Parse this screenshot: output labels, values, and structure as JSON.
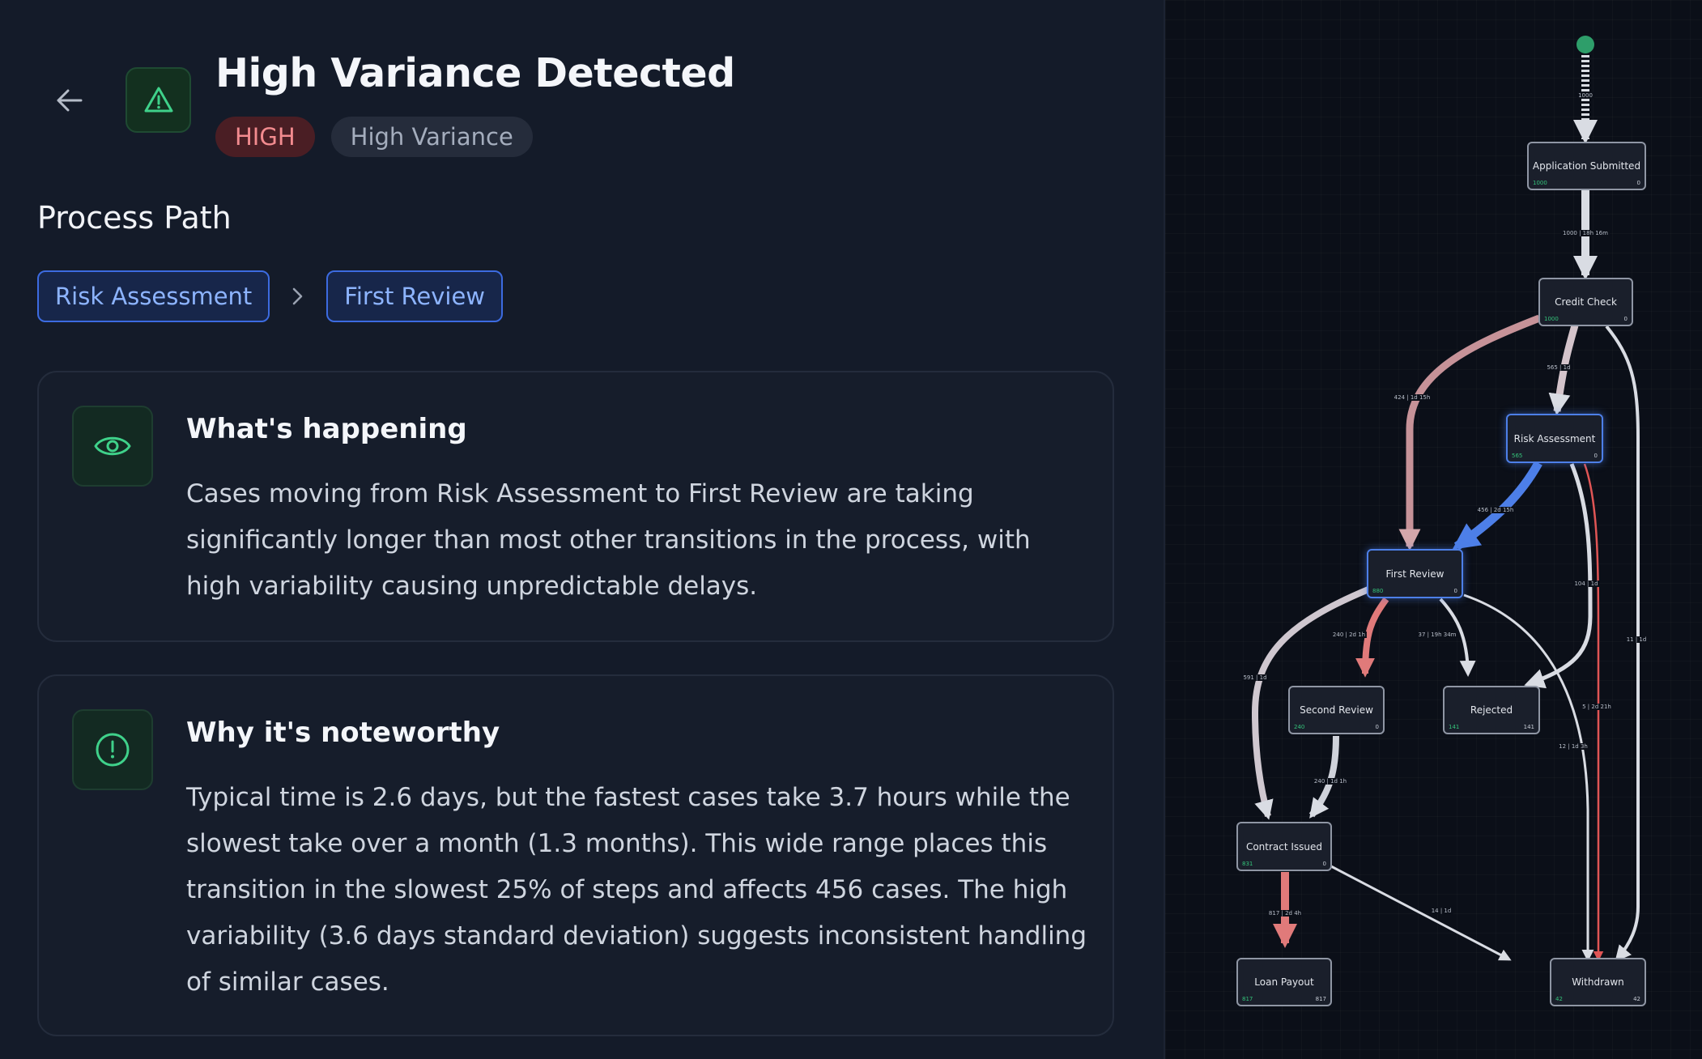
{
  "header": {
    "title": "High Variance Detected",
    "severity_badge": "HIGH",
    "type_badge": "High Variance"
  },
  "process_path": {
    "title": "Process Path",
    "steps": [
      "Risk Assessment",
      "First Review"
    ]
  },
  "cards": [
    {
      "title": "What's happening",
      "text": "Cases moving from Risk Assessment to First Review are taking significantly longer than most other transitions in the process, with high variability causing unpredictable delays."
    },
    {
      "title": "Why it's noteworthy",
      "text": "Typical time is 2.6 days, but the fastest cases take 3.7 hours while the slowest take over a month (1.3 months). This wide range places this transition in the slowest 25% of steps and affects 456 cases. The high variability (3.6 days standard deviation) suggests inconsistent handling of similar cases."
    }
  ],
  "graph": {
    "nodes": [
      {
        "label": "Application Submitted",
        "count": "1000",
        "end_count": "0"
      },
      {
        "label": "Credit Check",
        "count": "1000",
        "end_count": "0"
      },
      {
        "label": "Risk Assessment",
        "count": "565",
        "end_count": "0"
      },
      {
        "label": "First Review",
        "count": "880",
        "end_count": "0"
      },
      {
        "label": "Second Review",
        "count": "240",
        "end_count": "0"
      },
      {
        "label": "Rejected",
        "count": "141",
        "end_count": "141"
      },
      {
        "label": "Contract Issued",
        "count": "831",
        "end_count": "0"
      },
      {
        "label": "Loan Payout",
        "count": "817",
        "end_count": "817"
      },
      {
        "label": "Withdrawn",
        "count": "42",
        "end_count": "42"
      }
    ],
    "edge_labels": {
      "start_app": "1000",
      "app_credit": "1000 | 18h 16m",
      "credit_first": "424 | 1d 15h",
      "credit_risk": "565 | 1d",
      "credit_withdrawn": "11 | 1d",
      "risk_first": "456 | 2d 15h",
      "risk_rejected": "104 | 1d",
      "risk_withdrawn": "5 | 2d 21h",
      "first_second": "240 | 2d 1h",
      "first_rejected": "37 | 19h 34m",
      "first_contract": "591 | 1d",
      "first_withdrawn": "12 | 1d 3h",
      "second_contract": "240 | 1d 1h",
      "contract_payout": "817 | 2d 4h",
      "contract_withdrawn": "14 | 1d"
    },
    "colors": {
      "highlight": "#4d7fe8",
      "slow": "#e07a7a",
      "normal": "#cfd2da",
      "start": "#2e9e6a"
    }
  }
}
